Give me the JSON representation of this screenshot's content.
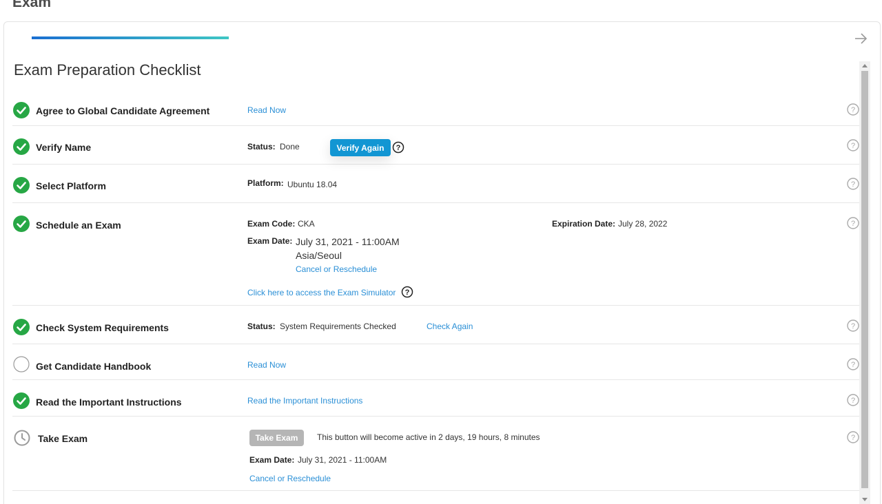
{
  "page": {
    "heading": "Exam"
  },
  "progress": {
    "fraction": 0.48
  },
  "checklist": {
    "title": "Exam Preparation Checklist",
    "items": [
      {
        "label": "Agree to Global Candidate Agreement",
        "status": "done",
        "link": "Read Now"
      },
      {
        "label": "Verify Name",
        "status": "done",
        "status_key": "Status:",
        "status_value": "Done",
        "button": "Verify Again"
      },
      {
        "label": "Select Platform",
        "status": "done",
        "platform_key": "Platform:",
        "platform_value": "Ubuntu 18.04"
      },
      {
        "label": "Schedule an Exam",
        "status": "done",
        "exam_code_key": "Exam Code:",
        "exam_code_value": "CKA",
        "expiration_key": "Expiration Date:",
        "expiration_value": "July 28, 2022",
        "exam_date_key": "Exam Date:",
        "exam_date_value": "July 31, 2021 - 11:00AM",
        "timezone": "Asia/Seoul",
        "reschedule_link": "Cancel or Reschedule",
        "simulator_link": "Click here to access the Exam Simulator"
      },
      {
        "label": "Check System Requirements",
        "status": "done",
        "status_key": "Status:",
        "status_value": "System Requirements Checked",
        "link": "Check Again"
      },
      {
        "label": "Get Candidate Handbook",
        "status": "pending",
        "link": "Read Now"
      },
      {
        "label": "Read the Important Instructions",
        "status": "done",
        "link": "Read the Important Instructions"
      },
      {
        "label": "Take Exam",
        "status": "waiting",
        "button": "Take Exam",
        "note": "This button will become active in 2 days, 19 hours, 8 minutes",
        "exam_date_key": "Exam Date:",
        "exam_date_value": "July 31, 2021 - 11:00AM",
        "reschedule_link": "Cancel or Reschedule"
      }
    ]
  },
  "colors": {
    "check_green": "#27a745",
    "link_blue": "#2a8fd6",
    "button_blue": "#1296d3",
    "disabled_gray": "#b5b5b5"
  },
  "icons": {
    "done": "check-circle-icon",
    "pending": "empty-circle-icon",
    "waiting": "clock-icon",
    "help": "question-circle-icon",
    "next": "arrow-right-icon"
  }
}
